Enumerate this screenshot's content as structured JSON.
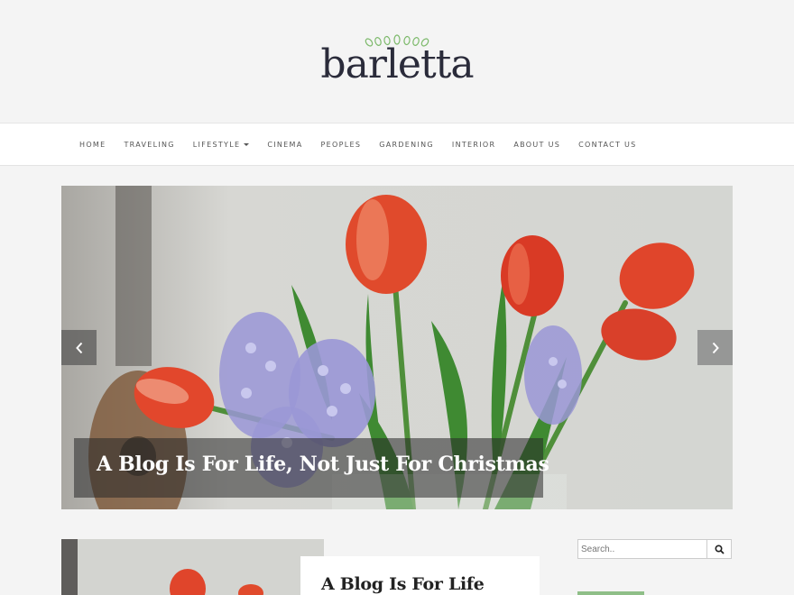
{
  "site": {
    "logo_text": "barletta",
    "logo_icon": "leaves-icon",
    "accent": "#7cb96a"
  },
  "nav": {
    "items": [
      {
        "label": "HOME"
      },
      {
        "label": "TRAVELING"
      },
      {
        "label": "LIFESTYLE",
        "dropdown": true
      },
      {
        "label": "CINEMA"
      },
      {
        "label": "PEOPLES"
      },
      {
        "label": "GARDENING"
      },
      {
        "label": "INTERIOR"
      },
      {
        "label": "ABOUT US"
      },
      {
        "label": "CONTACT US"
      }
    ]
  },
  "slider": {
    "title": "A Blog Is For Life, Not Just For Christmas",
    "prev_icon": "chevron-left-icon",
    "next_icon": "chevron-right-icon"
  },
  "post": {
    "title": "A Blog Is For Life"
  },
  "sidebar": {
    "search_placeholder": "Search..",
    "search_icon": "search-icon"
  }
}
